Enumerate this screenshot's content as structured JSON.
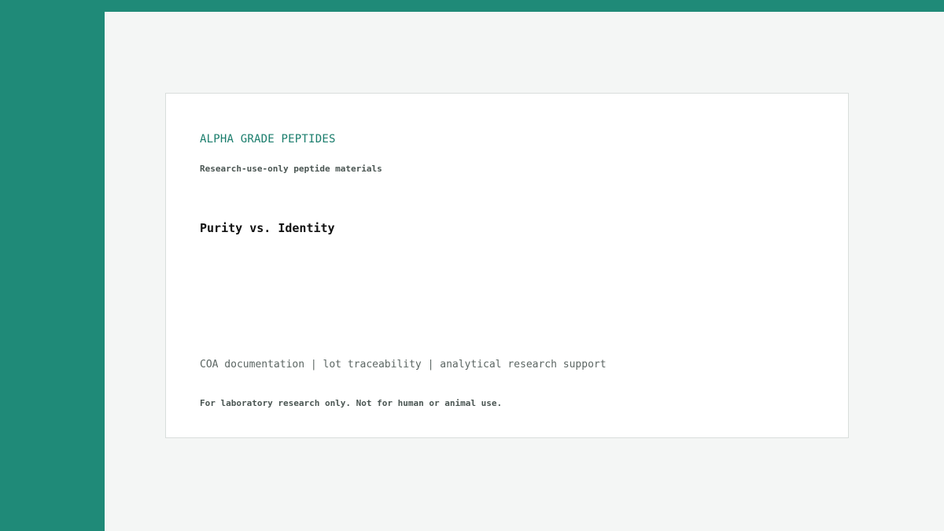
{
  "colors": {
    "accent": "#1f8a78",
    "brand_text": "#1a7d6c",
    "page_background": "#f4f6f5",
    "card_background": "#ffffff"
  },
  "card": {
    "brand": "ALPHA GRADE PEPTIDES",
    "subtitle": "Research-use-only peptide materials",
    "headline": "Purity vs. Identity",
    "features": "COA documentation | lot traceability | analytical research support",
    "disclaimer": "For laboratory research only. Not for human or animal use."
  }
}
